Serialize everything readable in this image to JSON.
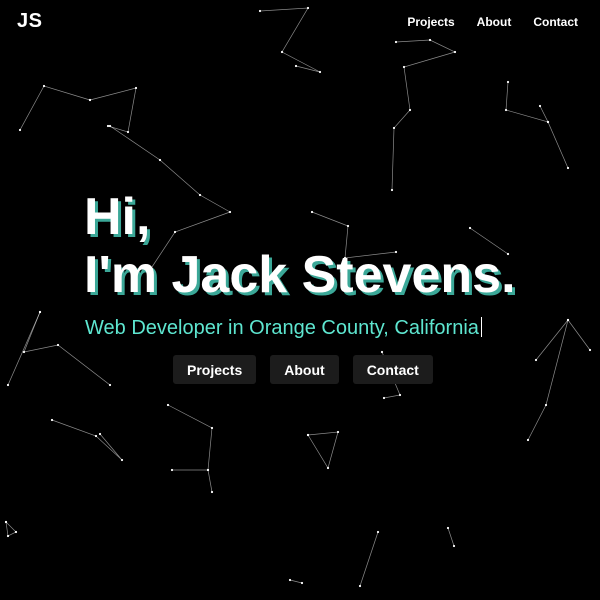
{
  "logo": {
    "text": "JS"
  },
  "nav": {
    "items": [
      "Projects",
      "About",
      "Contact"
    ]
  },
  "hero": {
    "greeting": "Hi,",
    "name_line": "I'm Jack Stevens.",
    "tagline": "Web Developer in Orange County, California"
  },
  "cta": {
    "buttons": [
      "Projects",
      "About",
      "Contact"
    ]
  },
  "colors": {
    "background": "#000000",
    "accent": "#5ee6d0",
    "shadow": "#3ba898",
    "button_bg": "#1c1c1c"
  }
}
